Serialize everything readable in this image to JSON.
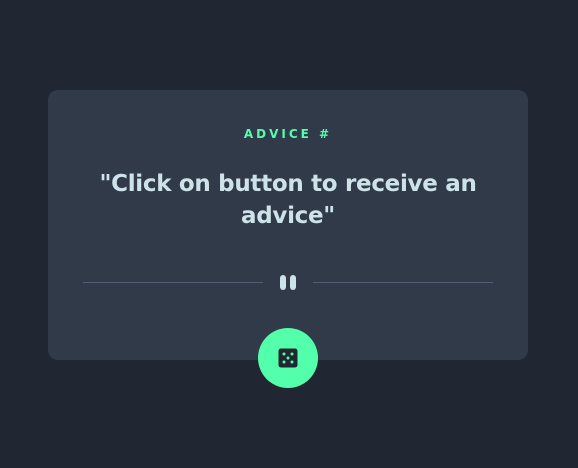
{
  "advice": {
    "label": "ADVICE #",
    "quote": "\"Click on button to receive an advice\""
  },
  "divider": {
    "icon": "pause-icon"
  },
  "generate_button": {
    "icon": "dice-icon"
  },
  "colors": {
    "background": "#202632",
    "card": "#313a48",
    "accent": "#53ffab",
    "text": "#cee3e9",
    "divider_line": "#4f5d74"
  }
}
